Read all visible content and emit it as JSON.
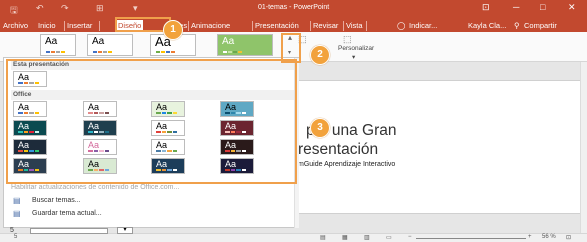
{
  "app": {
    "title": "01-temas - PowerPoint",
    "user": "Kayla Cla...",
    "tell_me": "Indicar...",
    "share": "Compartir",
    "win_min": "─",
    "win_max": "□",
    "win_close": "✕",
    "ribbon_display": "⊡"
  },
  "qat": {
    "save": "🖫",
    "undo": "↶",
    "redo": "↷",
    "start": "⊞",
    "more": "▾"
  },
  "tabs": [
    {
      "label": "Archivo"
    },
    {
      "label": "Inicio"
    },
    {
      "label": "Insertar"
    },
    {
      "label": "Diseño"
    },
    {
      "label": "nes"
    },
    {
      "label": "Animacione"
    },
    {
      "label": "Presentación"
    },
    {
      "label": "Revisar"
    },
    {
      "label": "Vista"
    }
  ],
  "ribbon": {
    "customize_label": "Personalizar",
    "customize_arrow": "▾",
    "more_arrow": "▾"
  },
  "themes_panel": {
    "section_presentation": "Esta presentación",
    "section_office": "Office",
    "enable_updates": "Habilitar actualizaciones de contenido de Office.com...",
    "browse": "Buscar temas...",
    "save": "Guardar tema actual..."
  },
  "theme_label": "Aa",
  "slide": {
    "title_line1": "p a una Gran",
    "title_line2": "resentación",
    "subtitle": "mGuide Aprendizaje Interactivo"
  },
  "status": {
    "slide_num": "5",
    "zoom": "56 %",
    "zoom_plus": "+",
    "zoom_minus": "−"
  },
  "badges": [
    "1",
    "2",
    "3"
  ],
  "colors": {
    "accent": "#c2492f",
    "highlight": "#f0a04b",
    "badge": "#f2a23c"
  }
}
